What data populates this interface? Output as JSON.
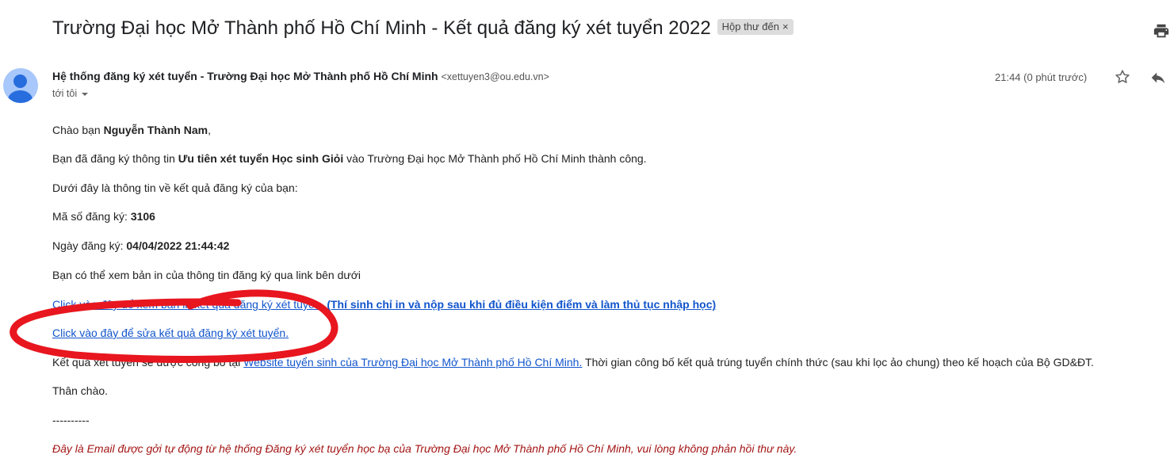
{
  "email": {
    "subject": "Trường Đại học Mở Thành phố Hồ Chí Minh - Kết quả đăng ký xét tuyển 2022",
    "label": "Hộp thư đến",
    "label_close": "×",
    "sender_name": "Hệ thống đăng ký xét tuyển - Trường Đại học Mở Thành phố Hồ Chí Minh",
    "sender_email": "<xettuyen3@ou.edu.vn>",
    "to": "tới tôi",
    "time": "21:44 (0 phút trước)"
  },
  "body": {
    "greeting_prefix": "Chào bạn ",
    "greeting_name": "Nguyễn Thành Nam",
    "greeting_suffix": ",",
    "line1_prefix": "Bạn đã đăng ký thông tin ",
    "line1_bold": "Ưu tiên xét tuyển Học sinh Giỏi",
    "line1_suffix": " vào Trường Đại học Mở Thành phố Hồ Chí Minh thành công.",
    "line2": "Dưới đây là thông tin về kết quả đăng ký của bạn:",
    "reg_code_label": "Mã số đăng ký: ",
    "reg_code_value": "3106",
    "reg_date_label": "Ngày đăng ký: ",
    "reg_date_value": "04/04/2022 21:44:42",
    "line3": "Bạn có thể xem bản in của thông tin đăng ký qua link bên dưới",
    "print_link": "Click vào đây để xem bản in kết quả đăng ký xét tuyển.",
    "print_note": "(Thí sinh chỉ in và nộp sau khi đủ điều kiện điểm và làm thủ tục nhập học)",
    "edit_link": "Click vào đây để sửa kết quả đăng ký xét tuyển.",
    "result_prefix": "Kết quả xét tuyển sẽ được công bố tại ",
    "result_link": "Website tuyển sinh của Trường Đại học Mở Thành phố Hồ Chí Minh.",
    "result_suffix": " Thời gian công bố kết quả trúng tuyển chính thức (sau khi lọc ảo chung) theo kế hoạch của Bộ GD&ĐT.",
    "closing": "Thân chào.",
    "separator": "----------",
    "auto_note": "Đây là Email được gởi tự động từ hệ thống Đăng ký xét tuyển học bạ của Trường Đại học Mở Thành phố Hồ Chí Minh, vui lòng không phản hồi thư này."
  },
  "icons": {
    "print": "printer-icon",
    "star": "star-icon",
    "reply": "reply-icon",
    "avatar": "avatar-icon"
  },
  "colors": {
    "link": "#1155cc",
    "annotation": "#e8161f",
    "auto_note": "#a31515"
  }
}
